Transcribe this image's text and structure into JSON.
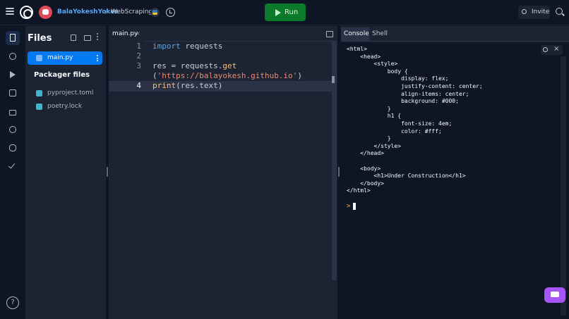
{
  "header": {
    "owner": "BalaYokeshYokes",
    "separator": "/",
    "repl_name": "WebScraping",
    "run_label": "Run",
    "invite_label": "Invite"
  },
  "files_panel": {
    "title": "Files",
    "files": [
      {
        "name": "main.py",
        "active": true
      }
    ],
    "packager_title": "Packager files",
    "packager_files": [
      "pyproject.toml",
      "poetry.lock"
    ]
  },
  "editor": {
    "tab_label": "main.py",
    "tab_close": "×",
    "lines": [
      {
        "num": "1"
      },
      {
        "num": "2"
      },
      {
        "num": "3"
      },
      {
        "num": "4"
      }
    ],
    "code": {
      "l1_kw": "import",
      "l1_rest": " requests",
      "l3_a": "res = requests.",
      "l3_fn": "get",
      "l3b_open": "(",
      "l3b_str": "'https://balayokesh.github.io'",
      "l3b_close": ")",
      "l4_fn": "print",
      "l4_rest": "(res.text)"
    }
  },
  "console": {
    "tabs": [
      "Console",
      "Shell"
    ],
    "output_lines": [
      "<html>",
      "    <head>",
      "        <style>",
      "            body {",
      "                display: flex;",
      "                justify-content: center;",
      "                align-items: center;",
      "                background: #000;",
      "            }",
      "            h1 {",
      "                font-size: 4em;",
      "                color: #fff;",
      "            }",
      "        </style>",
      "    </head>",
      "",
      "    <body>",
      "        <h1>Under Construction</h1>",
      "    </body>",
      "</html>"
    ],
    "prompt": ">",
    "close": "×"
  },
  "help_label": "?",
  "icons": [
    "menu-icon",
    "replit-logo-icon",
    "avatar",
    "python-icon",
    "history-icon",
    "play-icon",
    "invite-icon",
    "search-icon",
    "files-icon",
    "git-icon",
    "debugger-icon",
    "packages-icon",
    "secrets-icon",
    "settings-icon",
    "database-icon",
    "tests-icon",
    "help-icon",
    "chat-icon"
  ]
}
